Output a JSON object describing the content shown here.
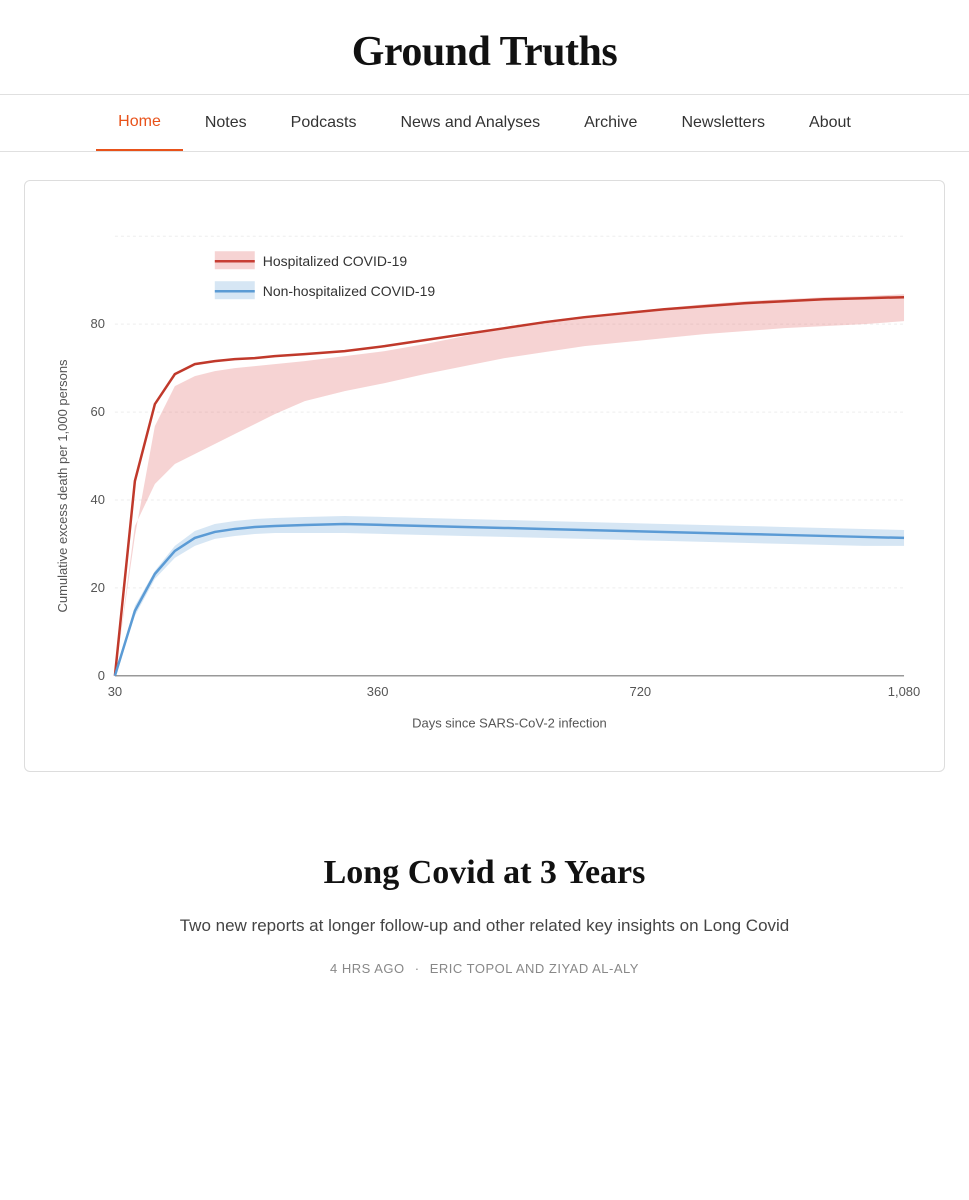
{
  "site": {
    "title": "Ground Truths"
  },
  "nav": {
    "items": [
      {
        "label": "Home",
        "active": true
      },
      {
        "label": "Notes",
        "active": false
      },
      {
        "label": "Podcasts",
        "active": false
      },
      {
        "label": "News and Analyses",
        "active": false
      },
      {
        "label": "Archive",
        "active": false
      },
      {
        "label": "Newsletters",
        "active": false
      },
      {
        "label": "About",
        "active": false
      }
    ]
  },
  "chart": {
    "y_label": "Cumulative excess death per 1,000 persons",
    "x_label": "Days since SARS-CoV-2 infection",
    "x_ticks": [
      "30",
      "360",
      "720",
      "1,080"
    ],
    "y_ticks": [
      "0",
      "20",
      "40",
      "60",
      "80"
    ],
    "legend": [
      {
        "label": "Hospitalized COVID-19",
        "color": "#c0392b"
      },
      {
        "label": "Non-hospitalized COVID-19",
        "color": "#5b9bd5"
      }
    ]
  },
  "article": {
    "title": "Long Covid at 3 Years",
    "subtitle": "Two new reports at longer follow-up and other related key insights on Long Covid",
    "time_ago": "4 HRS AGO",
    "authors": "ERIC TOPOL AND ZIYAD AL-ALY"
  }
}
